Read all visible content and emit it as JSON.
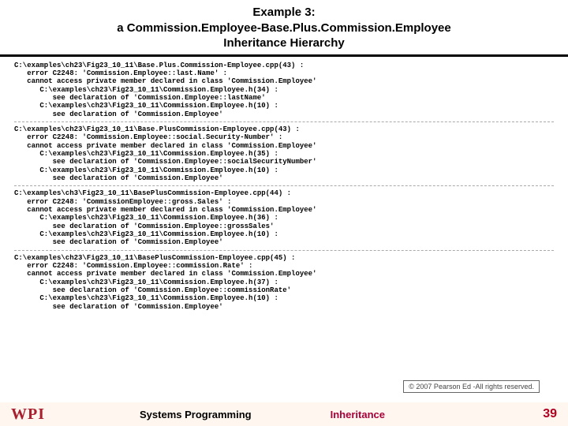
{
  "header": {
    "line1": "Example 3:",
    "line2": "a Commission.Employee-Base.Plus.Commission.Employee",
    "line3": "Inheritance Hierarchy"
  },
  "errors": [
    "C:\\examples\\ch23\\Fig23_10_11\\Base.Plus.Commission-Employee.cpp(43) :\n   error C2248: 'Commission.Employee::last.Name' :\n   cannot access private member declared in class 'Commission.Employee'\n      C:\\examples\\ch23\\Fig23_10_11\\Commission.Employee.h(34) :\n         see declaration of 'Commission.Employee::lastName'\n      C:\\examples\\ch23\\Fig23_10_11\\Commission.Employee.h(10) :\n         see declaration of 'Commission.Employee'",
    "C:\\examples\\ch23\\Fig23_10_11\\Base.PlusCommission-Employee.cpp(43) :\n   error C2248: 'Commission.Employee::social.Security-Number' :\n   cannot access private member declared in class 'Commission.Employee'\n      C:\\examples\\ch23\\Fig23_10_11\\Commission.Employee.h(35) :\n         see declaration of 'Commission.Employee::socialSecurityNumber'\n      C:\\examples\\ch23\\Fig23_10_11\\Commission.Employee.h(10) :\n         see declaration of 'Commission.Employee'",
    "C:\\examples\\ch3\\Fig23_10_11\\BasePlusCommission-Employee.cpp(44) :\n   error C2248: 'CommissionEmployee::gross.Sales' :\n   cannot access private member declared in class 'Commission.Employee'\n      C:\\examples\\ch23\\Fig23_10_11\\Commission.Employee.h(36) :\n         see declaration of 'Commission.Employee::grossSales'\n      C:\\examples\\ch23\\Fig23_10_11\\Commission.Employee.h(10) :\n         see declaration of 'Commission.Employee'",
    "C:\\examples\\ch23\\Fig23_10_11\\BasePlusCommission-Employee.cpp(45) :\n   error C2248: 'Commission.Employee::commission.Rate' :\n   cannot access private member declared in class 'Commission.Employee'\n      C:\\examples\\ch23\\Fig23_10_11\\Commission.Employee.h(37) :\n         see declaration of 'Commission.Employee::commissionRate'\n      C:\\examples\\ch23\\Fig23_10_11\\Commission.Employee.h(10) :\n         see declaration of 'Commission.Employee'"
  ],
  "copyright": "© 2007 Pearson Ed -All rights reserved.",
  "footer": {
    "logo": "WPI",
    "label1": "Systems Programming",
    "label2": "Inheritance",
    "pagenum": "39"
  }
}
